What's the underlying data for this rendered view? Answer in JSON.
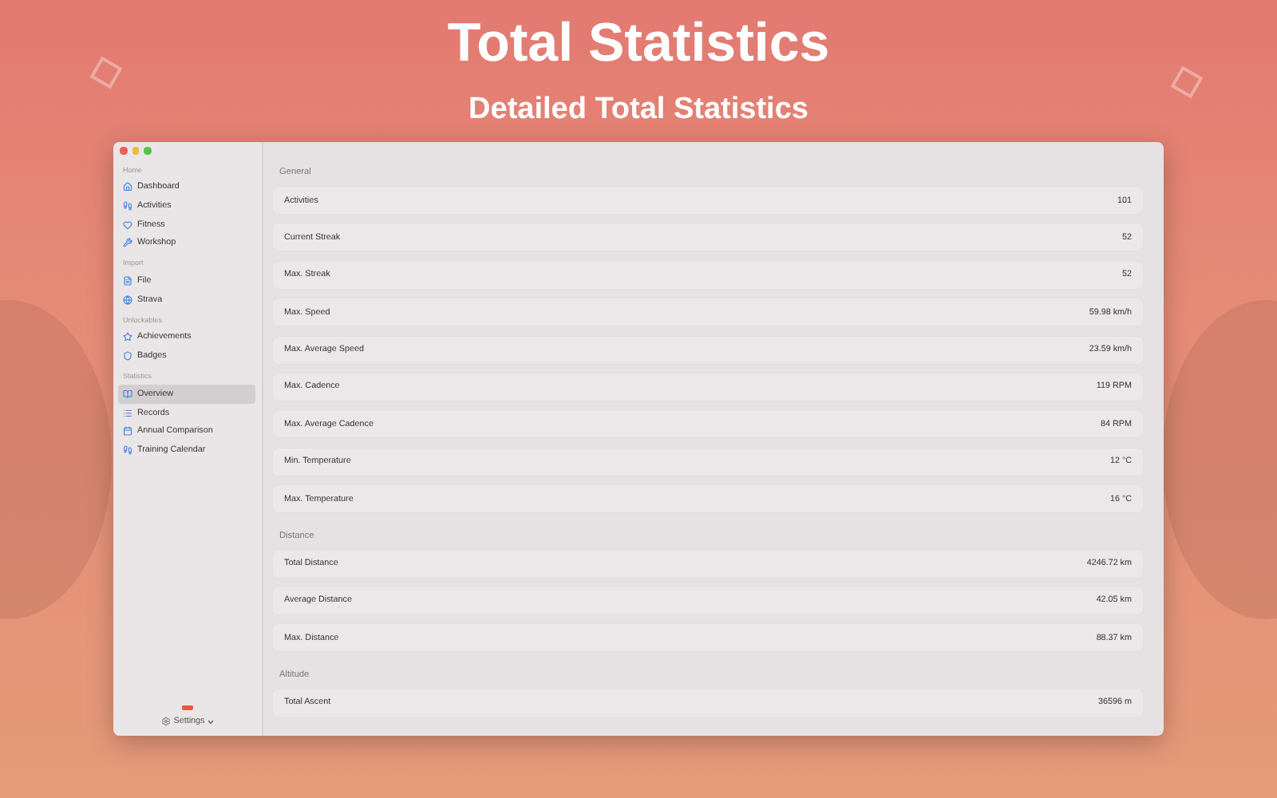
{
  "headline": "Total Statistics",
  "subheadline": "Detailed Total Statistics",
  "sidebar": {
    "sections": [
      {
        "title": "Home",
        "items": [
          {
            "label": "Dashboard",
            "selected": false
          },
          {
            "label": "Activities",
            "selected": false
          },
          {
            "label": "Fitness",
            "selected": false
          },
          {
            "label": "Workshop",
            "selected": false
          }
        ]
      },
      {
        "title": "Import",
        "items": [
          {
            "label": "File",
            "selected": false
          },
          {
            "label": "Strava",
            "selected": false
          }
        ]
      },
      {
        "title": "Unlockables",
        "items": [
          {
            "label": "Achievements",
            "selected": false
          },
          {
            "label": "Badges",
            "selected": false
          }
        ]
      },
      {
        "title": "Statistics",
        "items": [
          {
            "label": "Overview",
            "selected": true
          },
          {
            "label": "Records",
            "selected": false
          },
          {
            "label": "Annual Comparison",
            "selected": false
          },
          {
            "label": "Training Calendar",
            "selected": false
          }
        ]
      }
    ],
    "settings": "Settings"
  },
  "groups": [
    {
      "title": "General",
      "rows": [
        {
          "label": "Activities",
          "value": "101"
        },
        {
          "label": "Current Streak",
          "value": "52"
        },
        {
          "label": "Max. Streak",
          "value": "52"
        },
        {
          "label": "Max. Speed",
          "value": "59.98 km/h"
        },
        {
          "label": "Max. Average Speed",
          "value": "23.59 km/h"
        },
        {
          "label": "Max. Cadence",
          "value": "119 RPM"
        },
        {
          "label": "Max. Average Cadence",
          "value": "84 RPM"
        },
        {
          "label": "Min. Temperature",
          "value": "12 °C"
        },
        {
          "label": "Max. Temperature",
          "value": "16 °C"
        }
      ]
    },
    {
      "title": "Distance",
      "rows": [
        {
          "label": "Total Distance",
          "value": "4246.72 km"
        },
        {
          "label": "Average Distance",
          "value": "42.05 km"
        },
        {
          "label": "Max. Distance",
          "value": "88.37 km"
        }
      ]
    },
    {
      "title": "Altitude",
      "rows": [
        {
          "label": "Total Ascent",
          "value": "36596 m"
        }
      ]
    }
  ]
}
